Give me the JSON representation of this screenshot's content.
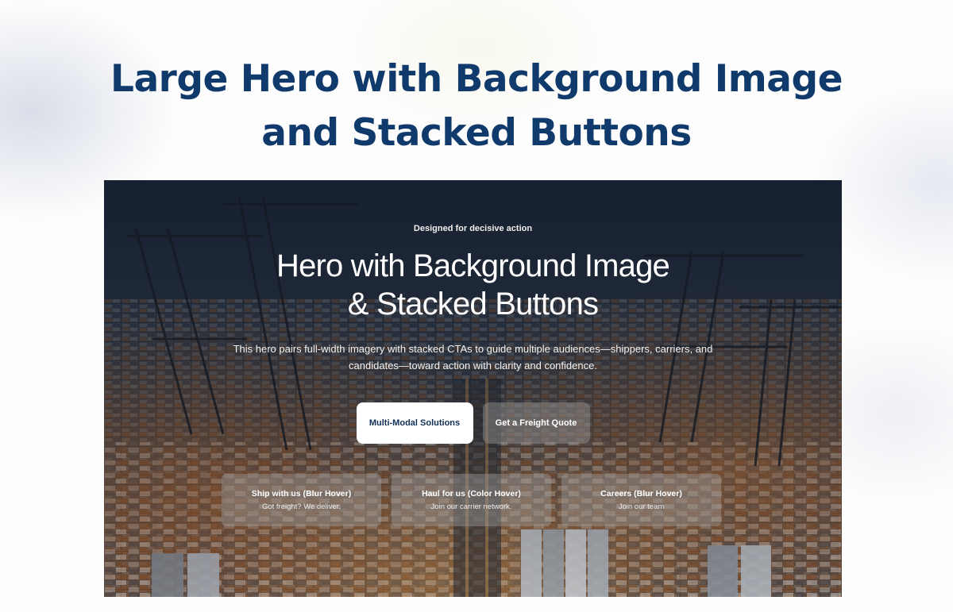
{
  "page": {
    "heading_line1": "Large Hero with Background Image",
    "heading_line2": "and Stacked Buttons"
  },
  "hero": {
    "eyebrow": "Designed for decisive action",
    "title_line1": "Hero with Background Image",
    "title_line2": "& Stacked Buttons",
    "description": "This hero pairs full-width imagery with stacked CTAs to guide multiple audiences—shippers, carriers, and candidates—toward action with clarity and confidence.",
    "buttons": {
      "primary_label": "Multi-Modal Solutions",
      "secondary_label": "Get a Freight Quote"
    },
    "cards": [
      {
        "title": "Ship with us (Blur Hover)",
        "subtitle": "Got freight? We deliver."
      },
      {
        "title": "Haul for us (Color Hover)",
        "subtitle": "Join our carrier network."
      },
      {
        "title": "Careers (Blur Hover)",
        "subtitle": "Join our team"
      }
    ],
    "background_image": "container-port-aerial-dusk"
  },
  "colors": {
    "heading": "#0f3a6b",
    "primary_button_bg": "#ffffff",
    "primary_button_text": "#0f2f55",
    "hero_text": "#ffffff"
  }
}
